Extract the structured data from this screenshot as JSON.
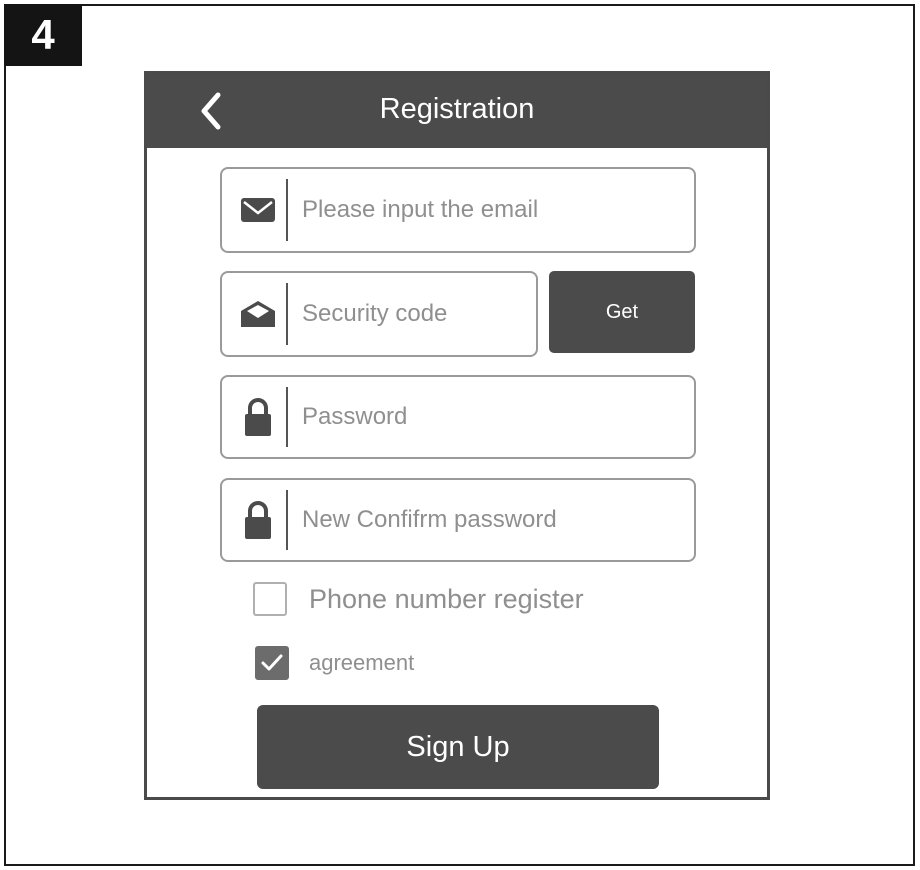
{
  "step": {
    "number": "4"
  },
  "header": {
    "title": "Registration",
    "back_icon": "chevron-left-icon"
  },
  "form": {
    "email": {
      "placeholder": "Please input the email",
      "value": "",
      "icon": "envelope-icon"
    },
    "security_code": {
      "placeholder": "Security code",
      "value": "",
      "icon": "open-envelope-icon"
    },
    "get_button": {
      "label": "Get"
    },
    "password": {
      "placeholder": "Password",
      "value": "",
      "icon": "lock-icon"
    },
    "confirm_password": {
      "placeholder": "New Confifrm password",
      "value": "",
      "icon": "lock-icon"
    },
    "phone_register": {
      "label": "Phone number register",
      "checked": false
    },
    "agreement": {
      "label": "agreement",
      "checked": true
    },
    "signup_button": {
      "label": "Sign Up"
    }
  },
  "colors": {
    "header_bg": "#4b4b4b",
    "button_bg": "#4b4b4b",
    "field_border": "#9a9a9a",
    "placeholder": "#8f8f8f"
  }
}
